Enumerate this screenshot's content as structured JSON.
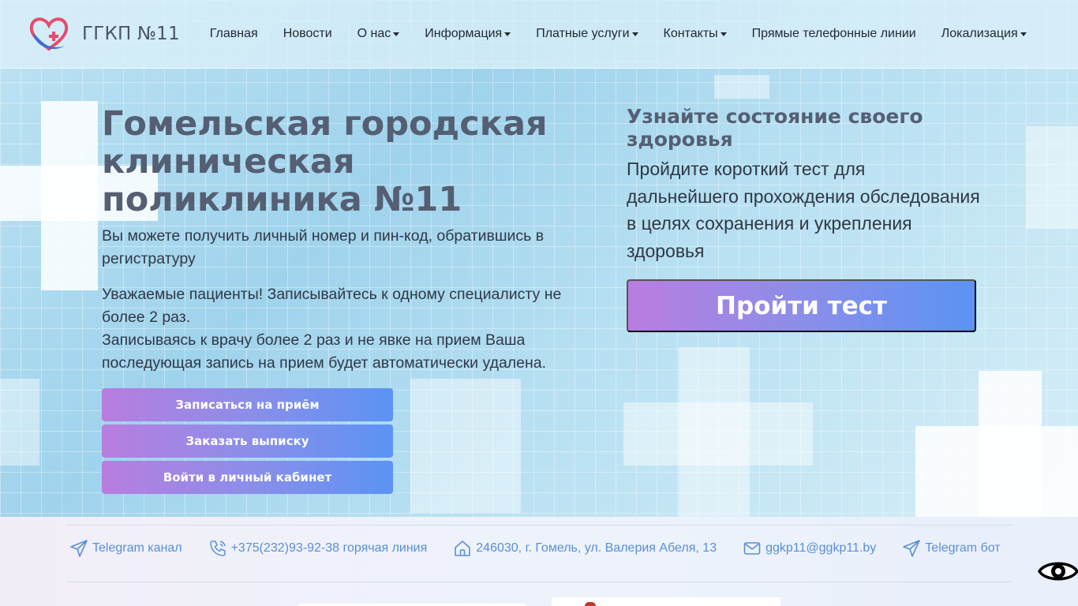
{
  "navbar": {
    "brand": "ГГКП №11",
    "items": [
      {
        "label": "Главная",
        "dropdown": false
      },
      {
        "label": "Новости",
        "dropdown": false
      },
      {
        "label": "О нас",
        "dropdown": true
      },
      {
        "label": "Информация",
        "dropdown": true
      },
      {
        "label": "Платные услуги",
        "dropdown": true
      },
      {
        "label": "Контакты",
        "dropdown": true
      },
      {
        "label": "Прямые телефонные линии",
        "dropdown": false
      },
      {
        "label": "Локализация",
        "dropdown": true
      }
    ]
  },
  "hero": {
    "title": "Гомельская городская клиническая поликлиника №11",
    "info": "Вы можете получить личный номер и пин-код, обратившись в регистратуру",
    "notice_line1": "Уважаемые пациенты! Записывайтесь к одному специалисту не более 2 раз.",
    "notice_line2": "Записываясь к врачу более 2 раз и не явке на прием Ваша последующая запись на прием будет автоматически удалена.",
    "buttons": [
      {
        "label": "Записаться на приём"
      },
      {
        "label": "Заказать выписку"
      },
      {
        "label": "Войти в личный кабинет"
      }
    ]
  },
  "test": {
    "title": "Узнайте состояние своего здоровья",
    "description": "Пройдите короткий тест для дальнейшего прохождения обследования в целях сохранения и укрепления здоровья",
    "button": "Пройти тест"
  },
  "contacts": [
    {
      "icon": "send-icon",
      "label": "Telegram канал"
    },
    {
      "icon": "phone-icon",
      "label": "+375(232)93-92-38 горячая линия"
    },
    {
      "icon": "home-icon",
      "label": "246030, г. Гомель, ул. Валерия Абеля, 13"
    },
    {
      "icon": "mail-icon",
      "label": "ggkp11@ggkp11.by"
    },
    {
      "icon": "send-icon",
      "label": "Telegram бот"
    }
  ],
  "colors": {
    "accent_link": "#5a8fd6",
    "gradient_start": "#b97ddf",
    "gradient_end": "#5b93f5",
    "title": "#555f73"
  }
}
